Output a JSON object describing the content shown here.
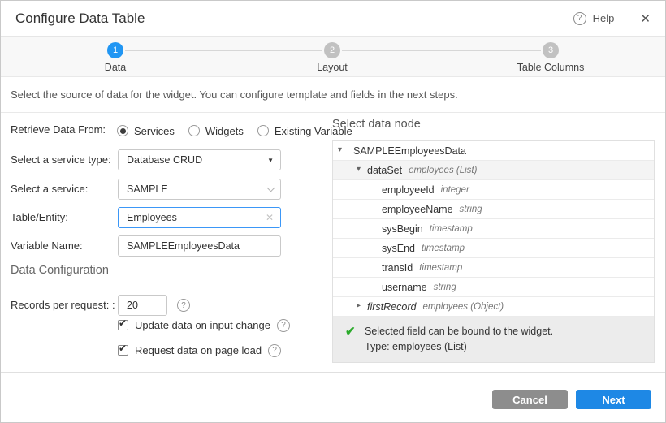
{
  "header": {
    "title": "Configure Data Table",
    "help_label": "Help",
    "close_icon": "close-icon",
    "help_icon": "question-circle-icon"
  },
  "stepper": {
    "steps": [
      {
        "num": "1",
        "label": "Data",
        "active": true
      },
      {
        "num": "2",
        "label": "Layout",
        "active": false
      },
      {
        "num": "3",
        "label": "Table Columns",
        "active": false
      }
    ]
  },
  "description": "Select the source of data for the widget. You can configure template and fields in the next steps.",
  "form": {
    "retrieve_label": "Retrieve Data From:",
    "radios": [
      {
        "label": "Services",
        "selected": true
      },
      {
        "label": "Widgets",
        "selected": false
      },
      {
        "label": "Existing Variable",
        "selected": false
      }
    ],
    "service_type": {
      "label": "Select a service type:",
      "value": "Database CRUD"
    },
    "service": {
      "label": "Select a service:",
      "value": "SAMPLE"
    },
    "table_entity": {
      "label": "Table/Entity:",
      "value": "Employees"
    },
    "variable_name": {
      "label": "Variable Name:",
      "value": "SAMPLEEmployeesData"
    },
    "data_config_title": "Data Configuration",
    "records_per_request": {
      "label": "Records per request: :",
      "value": "20"
    },
    "checkboxes": [
      {
        "label": "Update data on input change",
        "checked": true
      },
      {
        "label": "Request data on page load",
        "checked": true
      }
    ]
  },
  "data_node": {
    "title": "Select data node",
    "tree": [
      {
        "name": "SAMPLEEmployeesData",
        "type": "",
        "level": 0,
        "expander": "down",
        "selected": false,
        "italic_name": false
      },
      {
        "name": "dataSet",
        "type": "employees (List)",
        "level": 1,
        "expander": "down",
        "selected": true,
        "italic_name": false
      },
      {
        "name": "employeeId",
        "type": "integer",
        "level": 2,
        "expander": "",
        "selected": false,
        "italic_name": false
      },
      {
        "name": "employeeName",
        "type": "string",
        "level": 2,
        "expander": "",
        "selected": false,
        "italic_name": false
      },
      {
        "name": "sysBegin",
        "type": "timestamp",
        "level": 2,
        "expander": "",
        "selected": false,
        "italic_name": false
      },
      {
        "name": "sysEnd",
        "type": "timestamp",
        "level": 2,
        "expander": "",
        "selected": false,
        "italic_name": false
      },
      {
        "name": "transId",
        "type": "timestamp",
        "level": 2,
        "expander": "",
        "selected": false,
        "italic_name": false
      },
      {
        "name": "username",
        "type": "string",
        "level": 2,
        "expander": "",
        "selected": false,
        "italic_name": false
      },
      {
        "name": "firstRecord",
        "type": "employees (Object)",
        "level": 1,
        "expander": "right",
        "selected": false,
        "italic_name": true
      }
    ],
    "info": {
      "line1": "Selected field can be bound to the widget.",
      "line2": "Type: employees (List)",
      "check_icon": "green-check-icon"
    }
  },
  "footer": {
    "cancel_label": "Cancel",
    "next_label": "Next"
  },
  "colors": {
    "accent_blue": "#1e88e5",
    "step_active": "#2196f3",
    "step_inactive": "#c1c1c1",
    "success_green": "#2bab2b",
    "cancel_gray": "#8d8d8d",
    "focus_border": "#3b97f7"
  }
}
